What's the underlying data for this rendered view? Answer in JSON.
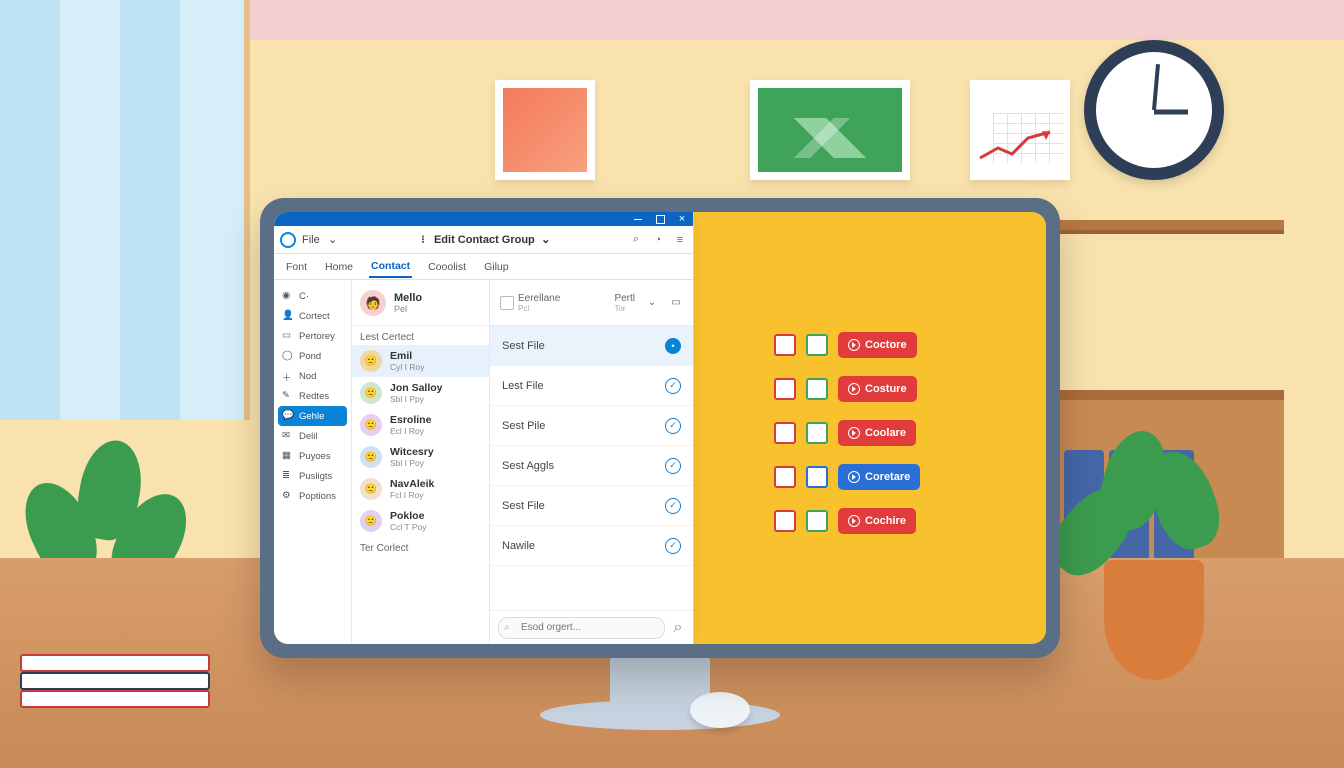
{
  "window": {
    "file_menu": "File",
    "title": "Edit Contact Group"
  },
  "ribbon": {
    "tabs": [
      "Font",
      "Home",
      "Contact",
      "Cooolist",
      "Gilup"
    ],
    "active_index": 2
  },
  "sidebar": {
    "items": [
      {
        "label": "C·",
        "icon": "app-icon"
      },
      {
        "label": "Cortect",
        "icon": "person-icon"
      },
      {
        "label": "Pertorey",
        "icon": "page-icon"
      },
      {
        "label": "Pond",
        "icon": "circle-icon"
      },
      {
        "label": "Nod",
        "icon": "plus-icon"
      },
      {
        "label": "Redtes",
        "icon": "pen-icon"
      },
      {
        "label": "Gehle",
        "icon": "chat-icon"
      },
      {
        "label": "Delil",
        "icon": "mail-icon"
      },
      {
        "label": "Puyoes",
        "icon": "grid-icon"
      },
      {
        "label": "Pusligts",
        "icon": "list-icon"
      },
      {
        "label": "Poptions",
        "icon": "gear-icon"
      }
    ],
    "active_index": 6
  },
  "mid_header": {
    "name": "Mello",
    "sub": "Pel"
  },
  "contacts_section": "Lest Certect",
  "contacts": [
    {
      "name": "Emil",
      "sub": "Cyl I Roy",
      "avatar_bg": "#f2d6a0"
    },
    {
      "name": "Jon Salloy",
      "sub": "Sbl I Ppy",
      "avatar_bg": "#cfe6cf"
    },
    {
      "name": "Esroline",
      "sub": "Ecl I Roy",
      "avatar_bg": "#e6cff0"
    },
    {
      "name": "Witcesry",
      "sub": "Sbl I Poy",
      "avatar_bg": "#d0e2f2"
    },
    {
      "name": "NavAleik",
      "sub": "Fcl I Roy",
      "avatar_bg": "#f2e0cf"
    },
    {
      "name": "Pokloe",
      "sub": "Ccl T Poy",
      "avatar_bg": "#e0d0f2"
    }
  ],
  "contacts_footer": "Ter Corlect",
  "detail_header": {
    "col1": "Eerellane",
    "col1_sub": "Pcl",
    "col2": "Pertl",
    "col2_sub": "Tor"
  },
  "files": [
    {
      "label": "Sest File",
      "checked": true
    },
    {
      "label": "Lest File",
      "checked": false
    },
    {
      "label": "Sest Pile",
      "checked": false
    },
    {
      "label": "Sest Aggls",
      "checked": false
    },
    {
      "label": "Sest File",
      "checked": false
    },
    {
      "label": "Nawile",
      "checked": false
    }
  ],
  "search_placeholder": "Esod orgert...",
  "panel_rows": [
    {
      "c1": "red",
      "c2": "green",
      "pill": "red",
      "label": "Coctore"
    },
    {
      "c1": "red",
      "c2": "green",
      "pill": "red",
      "label": "Costure"
    },
    {
      "c1": "red",
      "c2": "green",
      "pill": "red",
      "label": "Coolare"
    },
    {
      "c1": "red",
      "c2": "blue",
      "pill": "blue",
      "label": "Coretare"
    },
    {
      "c1": "red",
      "c2": "green",
      "pill": "red",
      "label": "Cochire"
    }
  ],
  "icons": {
    "search": "⌕",
    "bell": "◔",
    "menu": "≡",
    "chev": "⌄",
    "note": "▭"
  }
}
